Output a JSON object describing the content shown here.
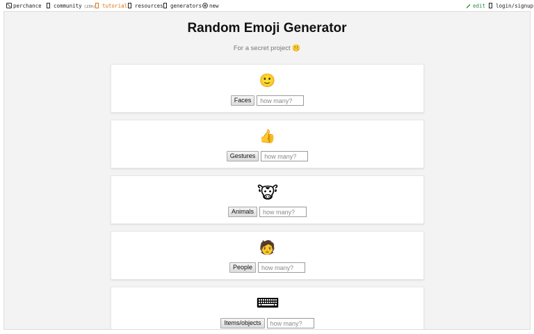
{
  "nav": {
    "brand": {
      "label": "perchance",
      "icon": "dice-icon"
    },
    "community": {
      "label": "community",
      "badge": "(23h)",
      "icon": "chat-icon"
    },
    "tutorial": {
      "label": "tutorial",
      "icon": "book-icon",
      "color": "#e0720f"
    },
    "resources": {
      "label": "resources",
      "icon": "toolbox-icon"
    },
    "generators": {
      "label": "generators",
      "icon": "list-icon"
    },
    "new": {
      "label": "new",
      "icon": "plus-circle-icon"
    },
    "edit": {
      "label": "edit",
      "icon": "pencil-icon",
      "color": "#2e8b3c"
    },
    "login": {
      "label": "login/signup",
      "icon": "user-icon"
    }
  },
  "page": {
    "title": "Random Emoji Generator",
    "subtitle": "For a secret project 🤫"
  },
  "cards": [
    {
      "button_label": "Faces",
      "placeholder": "how many?",
      "emoji": "🙂",
      "emoji_name": "face-emoji-icon"
    },
    {
      "button_label": "Gestures",
      "placeholder": "how many?",
      "emoji": "👍",
      "emoji_name": "gesture-emoji-icon"
    },
    {
      "button_label": "Animals",
      "placeholder": "how many?",
      "emoji": "🐮",
      "emoji_name": "cow-face-emoji-icon"
    },
    {
      "button_label": "People",
      "placeholder": "how many?",
      "emoji": "🧑",
      "emoji_name": "person-emoji-icon"
    },
    {
      "button_label": "Items/objects",
      "placeholder": "how many?",
      "emoji": "⌨",
      "emoji_name": "keyboard-emoji-icon"
    }
  ]
}
